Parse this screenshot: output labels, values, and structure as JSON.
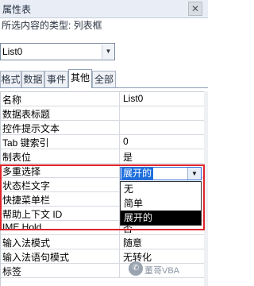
{
  "panel": {
    "title": "属性表",
    "close_icon": "✕",
    "selection_type": "所选内容的类型: 列表框"
  },
  "object_selector": {
    "value": "List0",
    "arrow_icon": "▼"
  },
  "tabs": [
    {
      "label": "格式",
      "active": false
    },
    {
      "label": "数据",
      "active": false
    },
    {
      "label": "事件",
      "active": false
    },
    {
      "label": "其他",
      "active": true
    },
    {
      "label": "全部",
      "active": false
    }
  ],
  "properties": [
    {
      "name": "名称",
      "value": "List0"
    },
    {
      "name": "数据表标题",
      "value": ""
    },
    {
      "name": "控件提示文本",
      "value": ""
    },
    {
      "name": "Tab 键索引",
      "value": "0"
    },
    {
      "name": "制表位",
      "value": "是"
    },
    {
      "name": "多重选择",
      "value": "展开的"
    },
    {
      "name": "状态栏文字",
      "value": ""
    },
    {
      "name": "快捷菜单栏",
      "value": ""
    },
    {
      "name": "帮助上下文 ID",
      "value": ""
    },
    {
      "name": "IME Hold",
      "value": "否"
    },
    {
      "name": "输入法模式",
      "value": "随意"
    },
    {
      "name": "输入法语句模式",
      "value": "无转化"
    },
    {
      "name": "标签",
      "value": ""
    }
  ],
  "multi_select_dropdown": {
    "current": "展开的",
    "arrow_icon": "▼",
    "options": [
      {
        "label": "无",
        "selected": false
      },
      {
        "label": "简单",
        "selected": false
      },
      {
        "label": "展开的",
        "selected": true
      }
    ]
  },
  "highlight_color": "#e0242c",
  "watermark": {
    "text": "董哥VBA"
  }
}
